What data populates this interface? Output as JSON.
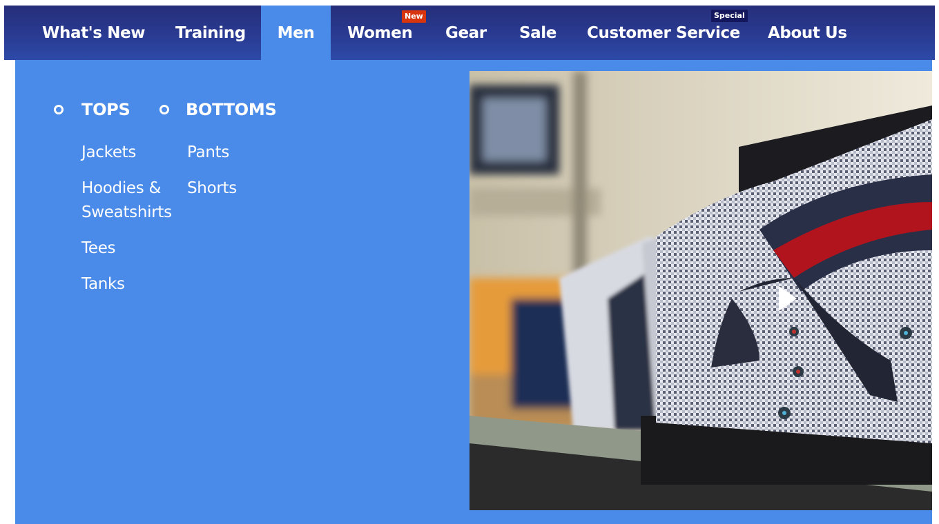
{
  "nav": {
    "items": [
      {
        "label": "What's New"
      },
      {
        "label": "Training"
      },
      {
        "label": "Men"
      },
      {
        "label": "Women",
        "badge": "New"
      },
      {
        "label": "Gear"
      },
      {
        "label": "Sale"
      },
      {
        "label": "Customer Service",
        "badge": "Special"
      },
      {
        "label": "About Us"
      }
    ],
    "active": "Men"
  },
  "menu": {
    "columns": [
      {
        "heading": "TOPS",
        "links": [
          "Jackets",
          "Hoodies & Sweatshirts",
          "Tees",
          "Tanks"
        ]
      },
      {
        "heading": "BOTTOMS",
        "links": [
          "Pants",
          "Shorts"
        ]
      }
    ]
  },
  "promo": {
    "icon": "play-icon"
  },
  "colors": {
    "nav_bg": "#2a3c94",
    "dropdown_bg": "#4a8ae8",
    "badge_new": "#d8340e",
    "badge_special": "#14175c"
  }
}
